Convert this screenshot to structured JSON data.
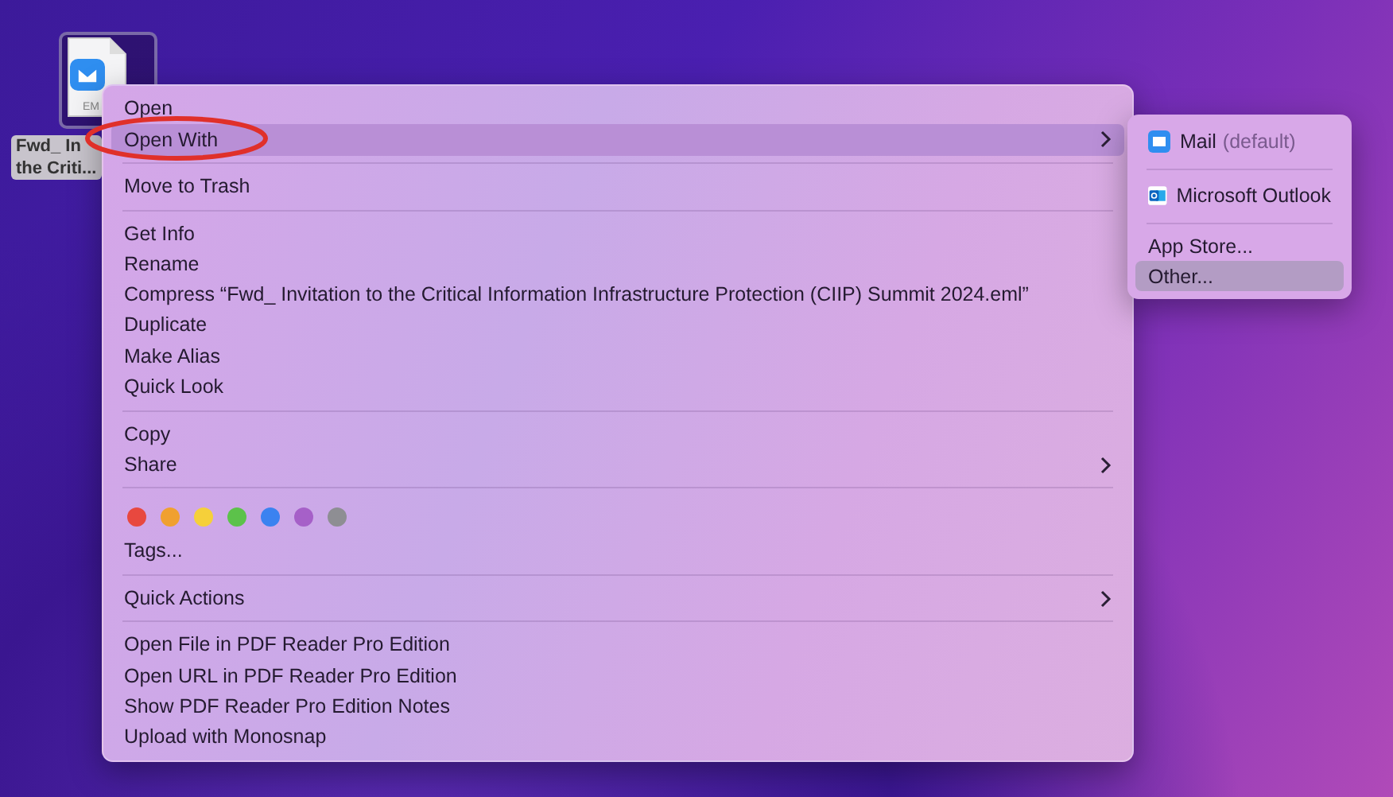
{
  "desktop_file": {
    "badge": "EM",
    "label_lines": [
      "Fwd_ In",
      "the Criti..."
    ]
  },
  "context_menu": {
    "sections": [
      {
        "items": [
          {
            "kind": "item",
            "label": "Open",
            "selected": false
          },
          {
            "kind": "submenu",
            "label": "Open With",
            "selected": true
          }
        ]
      },
      {
        "items": [
          {
            "kind": "item",
            "label": "Move to Trash",
            "selected": false
          }
        ]
      },
      {
        "items": [
          {
            "kind": "item",
            "label": "Get Info",
            "selected": false
          },
          {
            "kind": "item",
            "label": "Rename",
            "selected": false
          },
          {
            "kind": "item",
            "label": "Compress “Fwd_ Invitation to the Critical Information Infrastructure Protection (CIIP) Summit 2024.eml”",
            "selected": false
          },
          {
            "kind": "item",
            "label": "Duplicate",
            "selected": false
          },
          {
            "kind": "item",
            "label": "Make Alias",
            "selected": false
          },
          {
            "kind": "item",
            "label": "Quick Look",
            "selected": false
          }
        ]
      },
      {
        "items": [
          {
            "kind": "item",
            "label": "Copy",
            "selected": false
          },
          {
            "kind": "submenu",
            "label": "Share",
            "selected": false
          }
        ]
      },
      {
        "items": [
          {
            "kind": "tags",
            "dots": [
              {
                "color": "#e8483f"
              },
              {
                "color": "#f0a030"
              },
              {
                "color": "#f5d03a"
              },
              {
                "color": "#5cc24a"
              },
              {
                "color": "#3b82f0"
              },
              {
                "color": "#a660c8"
              },
              {
                "color": "#8e8e93"
              }
            ]
          },
          {
            "kind": "item",
            "label": "Tags...",
            "selected": false
          }
        ]
      },
      {
        "items": [
          {
            "kind": "submenu",
            "label": "Quick Actions",
            "selected": false
          }
        ]
      },
      {
        "items": [
          {
            "kind": "item",
            "label": "Open File in PDF Reader Pro Edition",
            "selected": false
          },
          {
            "kind": "item",
            "label": "Open URL in PDF Reader Pro Edition",
            "selected": false
          },
          {
            "kind": "item",
            "label": "Show PDF Reader Pro Edition Notes",
            "selected": false
          },
          {
            "kind": "item",
            "label": "Upload with Monosnap",
            "selected": false
          }
        ]
      }
    ]
  },
  "open_with_submenu": {
    "sections": [
      {
        "items": [
          {
            "kind": "mail",
            "label": "Mail",
            "note": "(default)",
            "selected": false
          }
        ]
      },
      {
        "items": [
          {
            "kind": "outlook",
            "label": "Microsoft Outlook",
            "selected": false
          }
        ]
      },
      {
        "items": [
          {
            "kind": "item",
            "label": "App Store...",
            "selected": false
          },
          {
            "kind": "item",
            "label": "Other...",
            "selected": true
          }
        ]
      }
    ]
  }
}
